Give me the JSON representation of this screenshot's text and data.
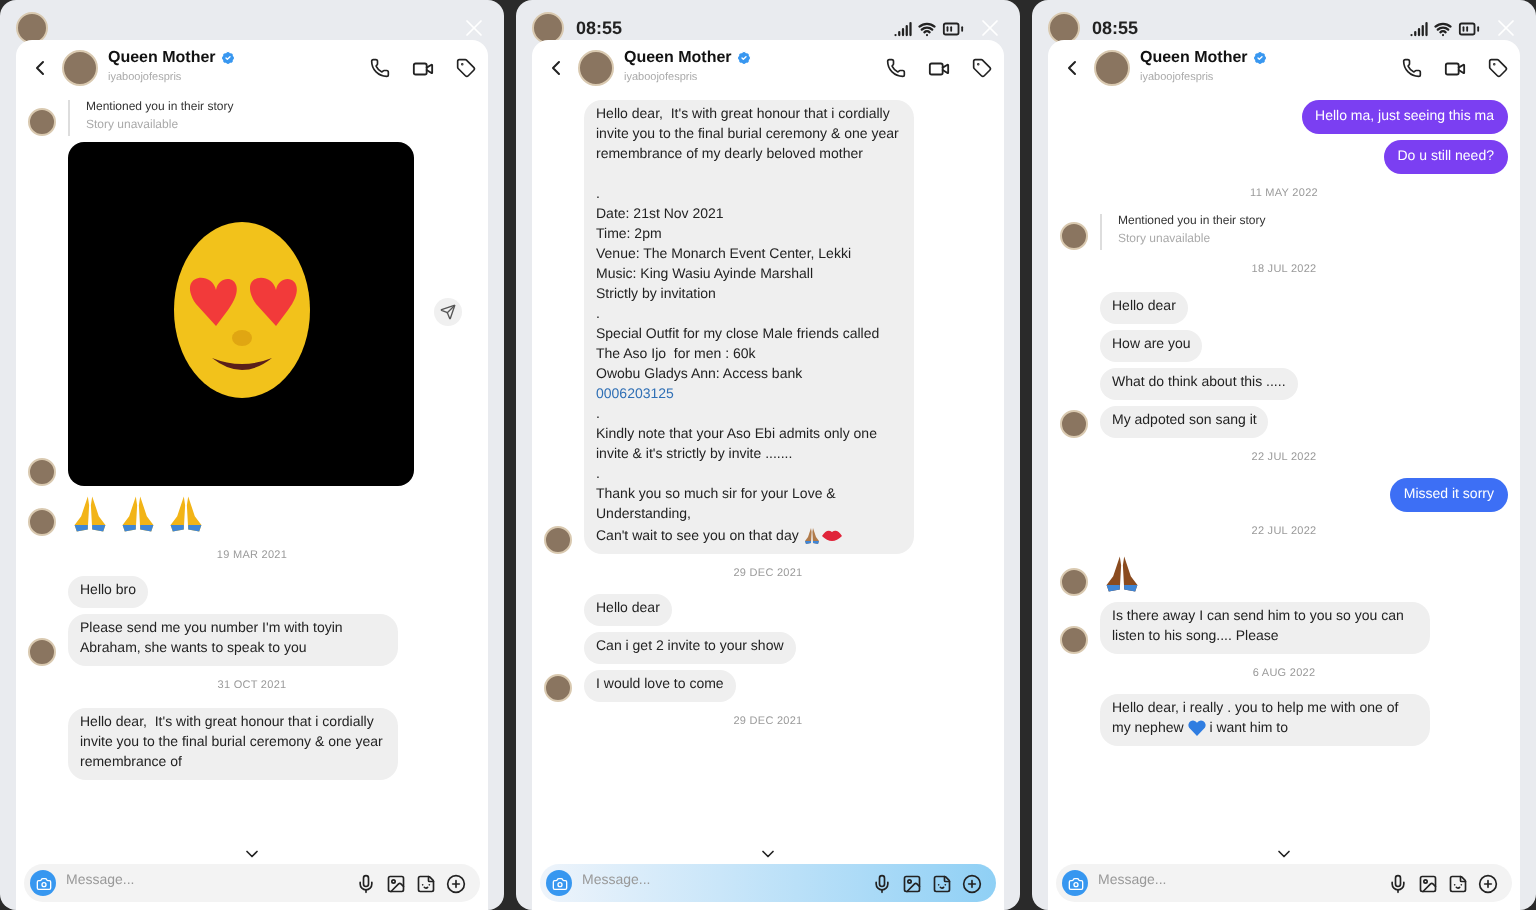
{
  "panels": [
    {
      "header": {
        "name": "Queen Mother",
        "handle": "iyaboojofespris"
      },
      "messages": [
        {
          "kind": "mention",
          "text": "Mentioned you in their story",
          "subtext": "Story unavailable",
          "avatar": true
        },
        {
          "kind": "image",
          "avatar": true
        },
        {
          "kind": "emoji",
          "avatar": true,
          "icons": [
            {
              "color": "#f2b417"
            },
            {
              "color": "#f2b417"
            },
            {
              "color": "#f2b417"
            }
          ]
        },
        {
          "kind": "date",
          "text": "19 MAR 2021"
        },
        {
          "kind": "in",
          "avatar": false,
          "parts": [
            {
              "kind": "text",
              "text": "Hello bro"
            }
          ]
        },
        {
          "kind": "in",
          "avatar": true,
          "parts": [
            {
              "kind": "text",
              "text": "Please send me you number I'm with toyin Abraham, she wants to speak to you"
            }
          ]
        },
        {
          "kind": "date",
          "text": "31 OCT 2021"
        },
        {
          "kind": "in",
          "avatar": false,
          "parts": [
            {
              "kind": "text",
              "text": "Hello dear,  It's with great honour that i cordially invite you to the final burial ceremony & one year remembrance of"
            }
          ]
        }
      ],
      "input": {
        "placeholder": "Message..."
      }
    },
    {
      "status": {
        "time": "08:55"
      },
      "header": {
        "name": "Queen Mother",
        "handle": "iyaboojofespris"
      },
      "messages": [
        {
          "kind": "in",
          "avatar": true,
          "parts": [
            {
              "kind": "text",
              "text": "Hello dear,  It's with great honour that i cordially invite you to the final burial ceremony & one year remembrance of my dearly beloved mother\n\n.\nDate: 21st Nov 2021\nTime: 2pm\nVenue: The Monarch Event Center, Lekki\nMusic: King Wasiu Ayinde Marshall\nStrictly by invitation\n.\nSpecial Outfit for my close Male friends called\nThe Aso Ijo  for men : 60k\nOwobu Gladys Ann: Access bank\n"
            },
            {
              "kind": "link",
              "text": "0006203125"
            },
            {
              "kind": "text",
              "text": "\n.\nKindly note that your Aso Ebi admits only one invite & it's strictly by invite .......\n.\nThank you so much sir for your Love & Understanding,\nCan't wait to see you on that day "
            },
            {
              "kind": "pray"
            },
            {
              "kind": "lips"
            }
          ]
        },
        {
          "kind": "date",
          "text": "29 DEC 2021"
        },
        {
          "kind": "in",
          "avatar": false,
          "parts": [
            {
              "kind": "text",
              "text": "Hello dear"
            }
          ]
        },
        {
          "kind": "in",
          "avatar": false,
          "parts": [
            {
              "kind": "text",
              "text": "Can i get 2 invite to your show"
            }
          ]
        },
        {
          "kind": "in",
          "avatar": true,
          "parts": [
            {
              "kind": "text",
              "text": "I would love to come"
            }
          ]
        },
        {
          "kind": "date",
          "text": "29 DEC 2021"
        }
      ],
      "input": {
        "placeholder": "Message..."
      }
    },
    {
      "status": {
        "time": "08:55"
      },
      "header": {
        "name": "Queen Mother",
        "handle": "iyaboojofespris"
      },
      "messages": [
        {
          "kind": "out",
          "color": "#7b3ff2",
          "text": "Hello ma, just seeing this ma"
        },
        {
          "kind": "out",
          "color": "#7b3ff2",
          "text": "Do u still need?"
        },
        {
          "kind": "date",
          "text": "11 MAY 2022"
        },
        {
          "kind": "mention",
          "text": "Mentioned you in their story",
          "subtext": "Story unavailable",
          "avatar": true
        },
        {
          "kind": "date",
          "text": "18 JUL 2022"
        },
        {
          "kind": "in",
          "avatar": false,
          "parts": [
            {
              "kind": "text",
              "text": "Hello dear"
            }
          ]
        },
        {
          "kind": "in",
          "avatar": false,
          "parts": [
            {
              "kind": "text",
              "text": "How are you"
            }
          ]
        },
        {
          "kind": "in",
          "avatar": false,
          "parts": [
            {
              "kind": "text",
              "text": "What do think about this ....."
            }
          ]
        },
        {
          "kind": "in",
          "avatar": true,
          "parts": [
            {
              "kind": "text",
              "text": "My adpoted son sang it"
            }
          ]
        },
        {
          "kind": "date",
          "text": "22 JUL 2022"
        },
        {
          "kind": "out",
          "color": "#3d6ff5",
          "text": "Missed it sorry"
        },
        {
          "kind": "date",
          "text": "22 JUL 2022"
        },
        {
          "kind": "emoji",
          "avatar": true,
          "icons": [
            {
              "color": "#8a4b1f"
            }
          ]
        },
        {
          "kind": "in",
          "avatar": true,
          "parts": [
            {
              "kind": "text",
              "text": "Is there away I can send him to you so you can listen to his song.... Please"
            }
          ]
        },
        {
          "kind": "date",
          "text": "6 AUG 2022"
        },
        {
          "kind": "in",
          "avatar": false,
          "parts": [
            {
              "kind": "text",
              "text": "Hello dear, i really . you to help me with one of my nephew "
            },
            {
              "kind": "heart"
            },
            {
              "kind": "text",
              "text": " i want him to"
            }
          ]
        }
      ],
      "input": {
        "placeholder": "Message..."
      }
    }
  ]
}
